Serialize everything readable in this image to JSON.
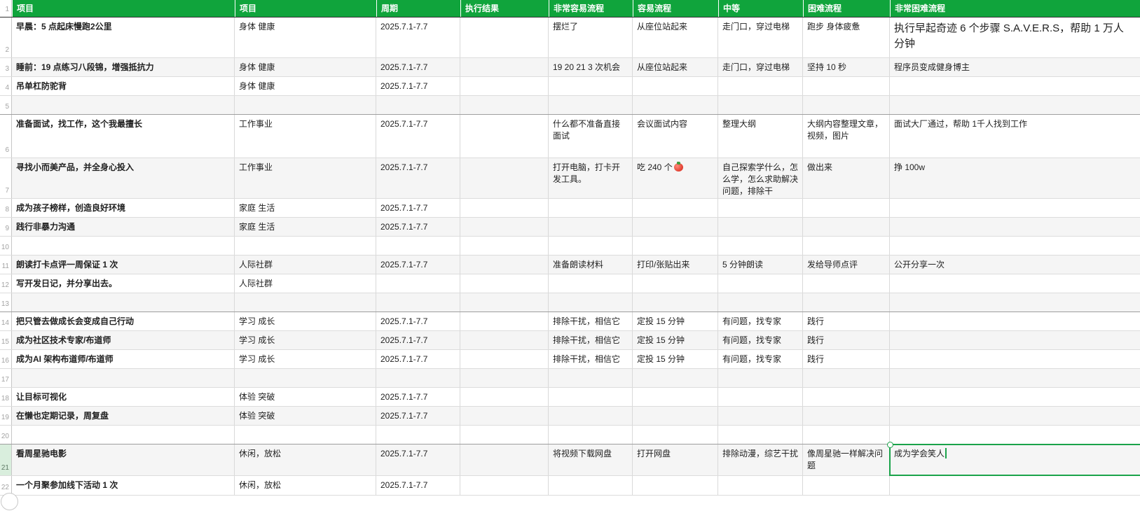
{
  "colors": {
    "header_bg": "#10a43c",
    "accent_green": "#1aa34a",
    "selected_gutter_bg": "#d9eedd",
    "alt_row_bg": "#f5f5f5",
    "grid_line": "#d9d9d9",
    "group_separator_line": "#9e9e9e"
  },
  "sheet": {
    "header": {
      "row_number": "1",
      "cells": [
        "项目",
        "项目",
        "周期",
        "执行结果",
        "非常容易流程",
        "容易流程",
        "中等",
        "困难流程",
        "非常困难流程"
      ]
    },
    "rows": [
      {
        "n": 2,
        "ht": 58,
        "a": "早晨：5 点起床慢跑2公里",
        "b": "身体 健康",
        "c": "2025.7.1-7.7",
        "e": "摆烂了",
        "f": "从座位站起来",
        "g": "走门口，穿过电梯",
        "h": "跑步 身体疲惫",
        "i": "执行早起奇迹 6 个步骤 S.A.V.E.R.S，帮助 1 万人\n分钟",
        "i_big": true
      },
      {
        "n": 3,
        "ht": 27,
        "a": "睡前：19 点练习八段锦，增强抵抗力",
        "b": "身体 健康",
        "c": "2025.7.1-7.7",
        "e": "19 20 21 3 次机会",
        "f": "从座位站起来",
        "g": "走门口，穿过电梯",
        "h": "坚持 10 秒",
        "i": "程序员变成健身博主"
      },
      {
        "n": 4,
        "ht": 27,
        "a": "吊单杠防驼背",
        "b": "身体 健康",
        "c": "2025.7.1-7.7"
      },
      {
        "n": 5,
        "ht": 27,
        "sep_after": true
      },
      {
        "n": 6,
        "ht": 62,
        "a": "准备面试，找工作，这个我最擅长",
        "b": "工作事业",
        "c": "2025.7.1-7.7",
        "e": "什么都不准备直接面试",
        "f": "会议面试内容",
        "g": "整理大纲",
        "h": "大纲内容整理文章，视频，图片",
        "i": "面试大厂通过，帮助 1千人找到工作"
      },
      {
        "n": 7,
        "ht": 58,
        "a": "寻找小而美产品，并全身心投入",
        "b": "工作事业",
        "c": "2025.7.1-7.7",
        "e": "打开电脑，打卡开发工具。",
        "f": "吃 240 个",
        "f_icon": "tomato",
        "g": "自己探索学什么，怎么学，怎么求助解决问题，排除干",
        "h": "做出来",
        "i": "挣 100w"
      },
      {
        "n": 8,
        "ht": 27,
        "a": "成为孩子榜样，创造良好环境",
        "b": "家庭 生活",
        "c": "2025.7.1-7.7"
      },
      {
        "n": 9,
        "ht": 27,
        "a": "践行非暴力沟通",
        "b": "家庭 生活",
        "c": "2025.7.1-7.7"
      },
      {
        "n": 10,
        "ht": 27
      },
      {
        "n": 11,
        "ht": 27,
        "a": "朗读打卡点评一周保证 1 次",
        "b": "人际社群",
        "c": "2025.7.1-7.7",
        "e": "准备朗读材料",
        "f": "打印/张贴出来",
        "g": "5 分钟朗读",
        "h": "发给导师点评",
        "i": "公开分享一次"
      },
      {
        "n": 12,
        "ht": 27,
        "a": "写开发日记，并分享出去。",
        "b": "人际社群"
      },
      {
        "n": 13,
        "ht": 27,
        "sep_after": true
      },
      {
        "n": 14,
        "ht": 27,
        "a": "把只管去做成长会变成自己行动",
        "b": "学习 成长",
        "c": "2025.7.1-7.7",
        "e": "排除干扰，相信它",
        "f": "定投 15 分钟",
        "g": "有问题，找专家",
        "h": "践行"
      },
      {
        "n": 15,
        "ht": 27,
        "a": "成为社区技术专家/布道师",
        "b": "学习 成长",
        "c": "2025.7.1-7.7",
        "e": "排除干扰，相信它",
        "f": "定投 15 分钟",
        "g": "有问题，找专家",
        "h": "践行"
      },
      {
        "n": 16,
        "ht": 27,
        "a": "成为AI 架构布道师/布道师",
        "b": "学习 成长",
        "c": "2025.7.1-7.7",
        "e": "排除干扰，相信它",
        "f": "定投 15 分钟",
        "g": "有问题，找专家",
        "h": "践行"
      },
      {
        "n": 17,
        "ht": 27
      },
      {
        "n": 18,
        "ht": 27,
        "a": "让目标可视化",
        "b": "体验 突破",
        "c": "2025.7.1-7.7"
      },
      {
        "n": 19,
        "ht": 27,
        "a": "在懒也定期记录，周复盘",
        "b": "体验 突破",
        "c": "2025.7.1-7.7"
      },
      {
        "n": 20,
        "ht": 27,
        "sep_after": true
      },
      {
        "n": 21,
        "ht": 45,
        "selected": true,
        "a": "看周星驰电影",
        "b": "休闲，放松",
        "c": "2025.7.1-7.7",
        "e": "将视频下载网盘",
        "f": "打开网盘",
        "g": "排除动漫，综艺干扰",
        "h": "像周星驰一样解决问题",
        "i": "成为学会笑人",
        "i_editing": true
      },
      {
        "n": 22,
        "ht": 28,
        "a": "一个月聚参加线下活动 1 次",
        "b": "休闲，放松",
        "c": "2025.7.1-7.7"
      }
    ]
  }
}
